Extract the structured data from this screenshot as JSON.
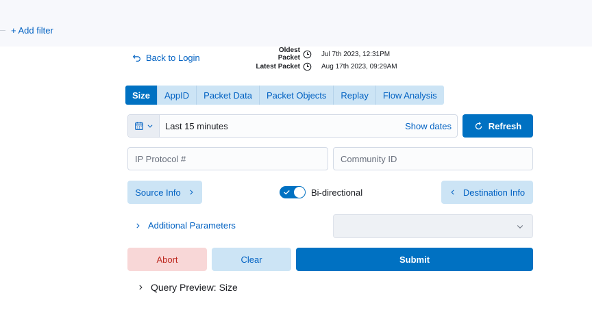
{
  "filter": {
    "add_label": "+ Add filter"
  },
  "nav": {
    "back_label": "Back to Login"
  },
  "packets": {
    "oldest_label": "Oldest Packet",
    "oldest_value": "Jul 7th 2023, 12:31PM",
    "latest_label": "Latest Packet",
    "latest_value": "Aug 17th 2023, 09:29AM"
  },
  "tabs": [
    {
      "label": "Size",
      "active": true
    },
    {
      "label": "AppID",
      "active": false
    },
    {
      "label": "Packet Data",
      "active": false
    },
    {
      "label": "Packet Objects",
      "active": false
    },
    {
      "label": "Replay",
      "active": false
    },
    {
      "label": "Flow Analysis",
      "active": false
    }
  ],
  "date_picker": {
    "range": "Last 15 minutes",
    "show_dates": "Show dates"
  },
  "refresh": {
    "label": "Refresh"
  },
  "inputs": {
    "ip_protocol_placeholder": "IP Protocol #",
    "community_id_placeholder": "Community ID"
  },
  "source_info": {
    "label": "Source Info"
  },
  "bidirectional": {
    "label": "Bi-directional",
    "checked": true
  },
  "destination_info": {
    "label": "Destination Info"
  },
  "additional": {
    "label": "Additional Parameters"
  },
  "actions": {
    "abort": "Abort",
    "clear": "Clear",
    "submit": "Submit"
  },
  "preview": {
    "label": "Query Preview: Size"
  },
  "colors": {
    "primary": "#0071c2",
    "primary_light": "#cce4f5",
    "danger_light": "#f8d7d7",
    "danger_text": "#bd271e"
  }
}
